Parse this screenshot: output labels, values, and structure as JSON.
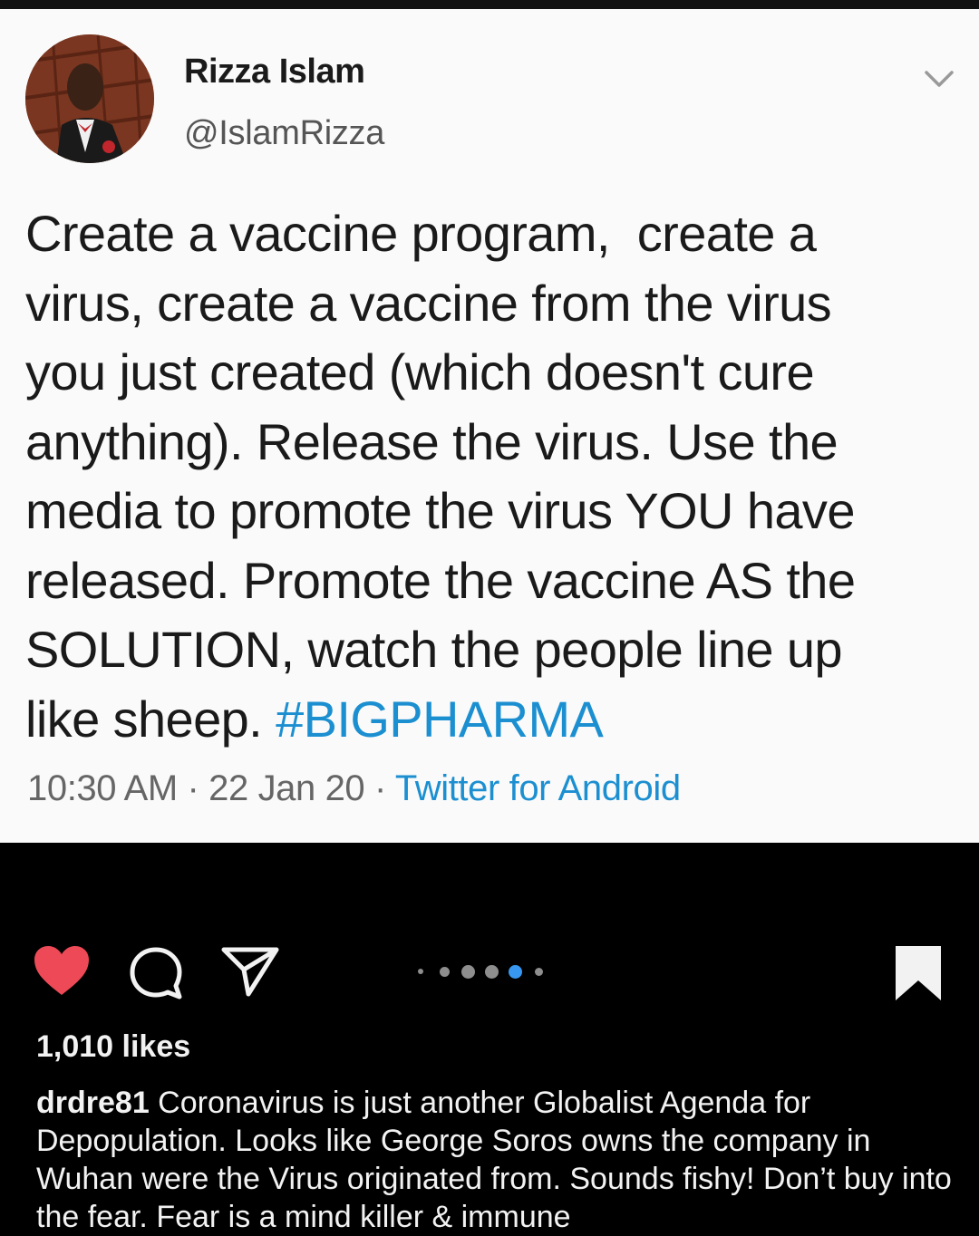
{
  "tweet": {
    "display_name": "Rizza Islam",
    "handle": "@IslamRizza",
    "text": "Create a vaccine program,  create a\nvirus, create a vaccine from the virus\nyou just created (which doesn't cure\nanything). Release the virus. Use the\nmedia to promote the virus YOU have\nreleased. Promote the vaccine AS the\nSOLUTION, watch the people line up\nlike sheep. ",
    "hashtag": "#BIGPHARMA",
    "time": "10:30 AM",
    "separator": " · ",
    "date": "22 Jan 20",
    "source": "Twitter for Android"
  },
  "post": {
    "likes": "1,010 likes",
    "caption_user": "drdre81",
    "caption_text": " Coronavirus is just another Globalist Agenda for Depopulation. Looks like George Soros owns the company in Wuhan were the Virus originated from. Sounds fishy! Don’t buy into the fear. Fear is a mind killer & immune",
    "carousel": {
      "count": 6,
      "active_index": 4
    }
  },
  "icons": {
    "chevron": "chevron-down-icon",
    "like": "heart-icon",
    "comment": "comment-icon",
    "share": "share-icon",
    "save": "bookmark-icon"
  },
  "colors": {
    "like_active": "#ed4956",
    "link_blue": "#1c8fd1",
    "carousel_active": "#3897f0",
    "card_background": "#fafafa",
    "app_background": "#000000"
  }
}
